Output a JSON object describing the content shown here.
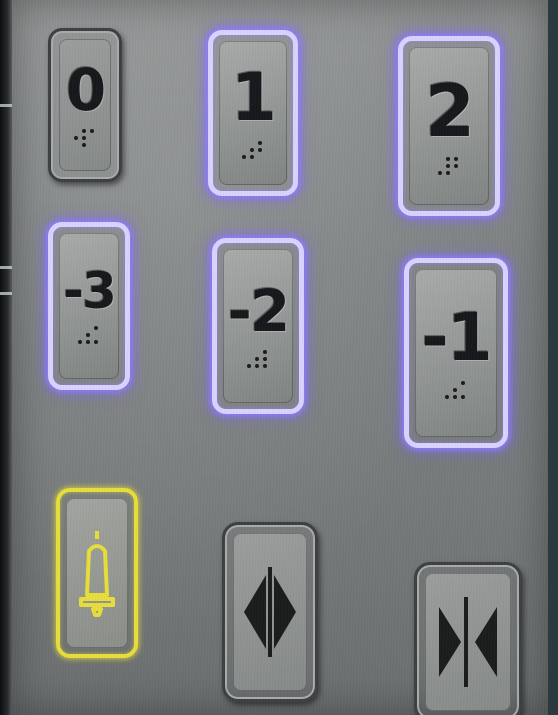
{
  "keypad": {
    "floor_buttons": [
      {
        "label": "0",
        "lit": false
      },
      {
        "label": "1",
        "lit": true
      },
      {
        "label": "2",
        "lit": true
      },
      {
        "label": "-3",
        "lit": true
      },
      {
        "label": "-2",
        "lit": true
      },
      {
        "label": "-1",
        "lit": true
      }
    ],
    "controls": [
      {
        "icon": "alarm-bell-icon",
        "lit": true
      },
      {
        "icon": "door-open-icon",
        "lit": false
      },
      {
        "icon": "door-close-icon",
        "lit": false
      }
    ]
  },
  "colors": {
    "lit_ring": "#8d7cff",
    "alarm_ring": "#e7dd3a",
    "panel": "#7f8383"
  }
}
